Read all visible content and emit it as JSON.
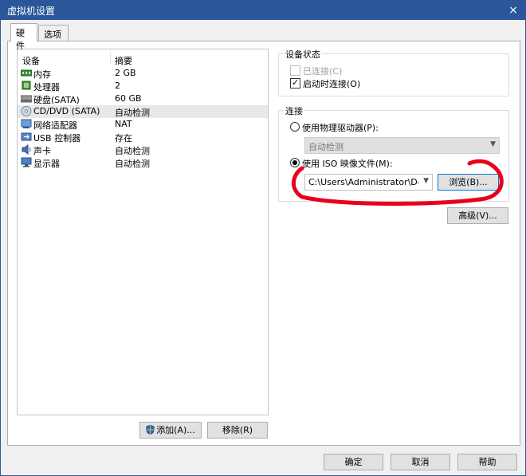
{
  "window": {
    "title": "虚拟机设置",
    "close": "×"
  },
  "tabs": [
    {
      "label": "硬件",
      "active": true
    },
    {
      "label": "选项",
      "active": false
    }
  ],
  "device_list": {
    "columns": {
      "device": "设备",
      "summary": "摘要"
    },
    "rows": [
      {
        "name": "内存",
        "summary": "2 GB",
        "icon": "memory-icon"
      },
      {
        "name": "处理器",
        "summary": "2",
        "icon": "processor-icon"
      },
      {
        "name": "硬盘(SATA)",
        "summary": "60 GB",
        "icon": "hard-disk-icon"
      },
      {
        "name": "CD/DVD (SATA)",
        "summary": "自动检测",
        "icon": "cd-dvd-icon",
        "selected": true
      },
      {
        "name": "网络适配器",
        "summary": "NAT",
        "icon": "network-adapter-icon"
      },
      {
        "name": "USB 控制器",
        "summary": "存在",
        "icon": "usb-icon"
      },
      {
        "name": "声卡",
        "summary": "自动检测",
        "icon": "sound-card-icon"
      },
      {
        "name": "显示器",
        "summary": "自动检测",
        "icon": "display-icon"
      }
    ]
  },
  "device_buttons": {
    "add": "添加(A)...",
    "remove": "移除(R)"
  },
  "device_status": {
    "title": "设备状态",
    "connected": {
      "label": "已连接(C)",
      "checked": false,
      "enabled": false
    },
    "connect_at_power_on": {
      "label": "启动时连接(O)",
      "checked": true,
      "enabled": true
    }
  },
  "connection": {
    "title": "连接",
    "physical_drive": {
      "label": "使用物理驱动器(P):",
      "selected": false,
      "value": "自动检测"
    },
    "iso_image": {
      "label": "使用 ISO 映像文件(M):",
      "selected": true,
      "path": "C:\\Users\\Administrator\\Desk"
    },
    "browse": "浏览(B)..."
  },
  "advanced": "高级(V)...",
  "footer": {
    "ok": "确定",
    "cancel": "取消",
    "help": "帮助"
  },
  "colors": {
    "titlebar": "#2b579a",
    "annotation": "#e8001c",
    "focus": "#0078d7"
  }
}
